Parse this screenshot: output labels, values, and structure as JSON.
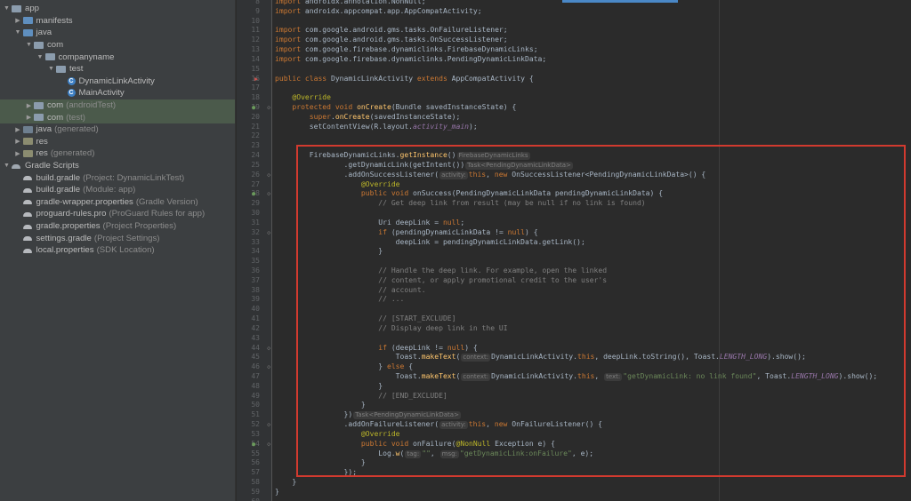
{
  "project_tree": [
    {
      "label": "app",
      "hint": "",
      "icon": "folder",
      "arrow": "down",
      "level": 0,
      "selected": false
    },
    {
      "label": "manifests",
      "hint": "",
      "icon": "folder-blue",
      "arrow": "right",
      "level": 1,
      "selected": false
    },
    {
      "label": "java",
      "hint": "",
      "icon": "folder-blue",
      "arrow": "down",
      "level": 1,
      "selected": false
    },
    {
      "label": "com",
      "hint": "",
      "icon": "folder",
      "arrow": "down",
      "level": 2,
      "selected": false
    },
    {
      "label": "companyname",
      "hint": "",
      "icon": "folder",
      "arrow": "down",
      "level": 3,
      "selected": false
    },
    {
      "label": "test",
      "hint": "",
      "icon": "folder",
      "arrow": "down",
      "level": 4,
      "selected": false
    },
    {
      "label": "DynamicLinkActivity",
      "hint": "",
      "icon": "class",
      "arrow": "none",
      "level": 5,
      "selected": false
    },
    {
      "label": "MainActivity",
      "hint": "",
      "icon": "class",
      "arrow": "none",
      "level": 5,
      "selected": false
    },
    {
      "label": "com",
      "hint": "(androidTest)",
      "icon": "folder",
      "arrow": "right",
      "level": 2,
      "selected": true
    },
    {
      "label": "com",
      "hint": "(test)",
      "icon": "folder",
      "arrow": "right",
      "level": 2,
      "selected": true
    },
    {
      "label": "java",
      "hint": "(generated)",
      "icon": "folder-dark",
      "arrow": "right",
      "level": 1,
      "selected": false
    },
    {
      "label": "res",
      "hint": "",
      "icon": "folder-res",
      "arrow": "right",
      "level": 1,
      "selected": false
    },
    {
      "label": "res",
      "hint": "(generated)",
      "icon": "folder-res",
      "arrow": "right",
      "level": 1,
      "selected": false
    },
    {
      "label": "Gradle Scripts",
      "hint": "",
      "icon": "gradle",
      "arrow": "down",
      "level": 0,
      "selected": false
    },
    {
      "label": "build.gradle",
      "hint": "(Project: DynamicLinkTest)",
      "icon": "gradle-file",
      "arrow": "none",
      "level": 1,
      "selected": false
    },
    {
      "label": "build.gradle",
      "hint": "(Module: app)",
      "icon": "gradle-file",
      "arrow": "none",
      "level": 1,
      "selected": false
    },
    {
      "label": "gradle-wrapper.properties",
      "hint": "(Gradle Version)",
      "icon": "gradle-file",
      "arrow": "none",
      "level": 1,
      "selected": false
    },
    {
      "label": "proguard-rules.pro",
      "hint": "(ProGuard Rules for app)",
      "icon": "gradle-file",
      "arrow": "none",
      "level": 1,
      "selected": false
    },
    {
      "label": "gradle.properties",
      "hint": "(Project Properties)",
      "icon": "gradle-file",
      "arrow": "none",
      "level": 1,
      "selected": false
    },
    {
      "label": "settings.gradle",
      "hint": "(Project Settings)",
      "icon": "gradle-file",
      "arrow": "none",
      "level": 1,
      "selected": false
    },
    {
      "label": "local.properties",
      "hint": "(SDK Location)",
      "icon": "gradle-file",
      "arrow": "none",
      "level": 1,
      "selected": false
    }
  ],
  "code_lines": [
    {
      "n": "8",
      "t": [
        [
          "k",
          "import "
        ],
        [
          "m",
          "androidx.annotation.NonNull;"
        ]
      ]
    },
    {
      "n": "9",
      "t": [
        [
          "k",
          "import "
        ],
        [
          "m",
          "androidx.appcompat.app.AppCompatActivity;"
        ]
      ]
    },
    {
      "n": "10",
      "t": []
    },
    {
      "n": "11",
      "t": [
        [
          "k",
          "import "
        ],
        [
          "m",
          "com.google.android.gms.tasks.OnFailureListener;"
        ]
      ]
    },
    {
      "n": "12",
      "t": [
        [
          "k",
          "import "
        ],
        [
          "m",
          "com.google.android.gms.tasks.OnSuccessListener;"
        ]
      ]
    },
    {
      "n": "13",
      "t": [
        [
          "k",
          "import "
        ],
        [
          "m",
          "com.google.firebase.dynamiclinks.FirebaseDynamicLinks;"
        ]
      ]
    },
    {
      "n": "14",
      "t": [
        [
          "k",
          "import "
        ],
        [
          "m",
          "com.google.firebase.dynamiclinks.PendingDynamicLinkData;"
        ]
      ]
    },
    {
      "n": "15",
      "t": []
    },
    {
      "n": "16",
      "t": [
        [
          "k",
          "public class "
        ],
        [
          "m",
          "DynamicLinkActivity "
        ],
        [
          "k",
          "extends "
        ],
        [
          "m",
          "AppCompatActivity {"
        ]
      ]
    },
    {
      "n": "17",
      "t": []
    },
    {
      "n": "18",
      "t": [
        [
          "m",
          "    "
        ],
        [
          "a",
          "@Override"
        ]
      ]
    },
    {
      "n": "19",
      "t": [
        [
          "m",
          "    "
        ],
        [
          "k",
          "protected void "
        ],
        [
          "f",
          "onCreate"
        ],
        [
          "m",
          "(Bundle savedInstanceState) {"
        ]
      ]
    },
    {
      "n": "20",
      "t": [
        [
          "m",
          "        "
        ],
        [
          "k",
          "super"
        ],
        [
          "m",
          "."
        ],
        [
          "f",
          "onCreate"
        ],
        [
          "m",
          "(savedInstanceState);"
        ]
      ]
    },
    {
      "n": "21",
      "t": [
        [
          "m",
          "        setContentView(R.layout."
        ],
        [
          "st",
          "activity_main"
        ],
        [
          "m",
          ");"
        ]
      ]
    },
    {
      "n": "22",
      "t": []
    },
    {
      "n": "23",
      "t": []
    },
    {
      "n": "24",
      "t": [
        [
          "m",
          "        FirebaseDynamicLinks."
        ],
        [
          "f",
          "getInstance"
        ],
        [
          "m",
          "()"
        ],
        [
          "ph",
          "FirebaseDynamicLinks"
        ]
      ]
    },
    {
      "n": "25",
      "t": [
        [
          "m",
          "                .getDynamicLink(getIntent())"
        ],
        [
          "ph",
          "Task<PendingDynamicLinkData>"
        ]
      ]
    },
    {
      "n": "26",
      "t": [
        [
          "m",
          "                .addOnSuccessListener("
        ],
        [
          "ph",
          "activity:"
        ],
        [
          "k",
          "this"
        ],
        [
          "m",
          ", "
        ],
        [
          "k",
          "new "
        ],
        [
          "m",
          "OnSuccessListener<PendingDynamicLinkData>() {"
        ]
      ]
    },
    {
      "n": "27",
      "t": [
        [
          "m",
          "                    "
        ],
        [
          "a",
          "@Override"
        ]
      ]
    },
    {
      "n": "28",
      "t": [
        [
          "m",
          "                    "
        ],
        [
          "k",
          "public void "
        ],
        [
          "m",
          "onSuccess(PendingDynamicLinkData pendingDynamicLinkData) {"
        ]
      ]
    },
    {
      "n": "29",
      "t": [
        [
          "m",
          "                        "
        ],
        [
          "c",
          "// Get deep link from result (may be null if no link is found)"
        ]
      ]
    },
    {
      "n": "30",
      "t": []
    },
    {
      "n": "31",
      "t": [
        [
          "m",
          "                        Uri deepLink = "
        ],
        [
          "k",
          "null"
        ],
        [
          "m",
          ";"
        ]
      ]
    },
    {
      "n": "32",
      "t": [
        [
          "m",
          "                        "
        ],
        [
          "k",
          "if "
        ],
        [
          "m",
          "(pendingDynamicLinkData != "
        ],
        [
          "k",
          "null"
        ],
        [
          "m",
          ") {"
        ]
      ]
    },
    {
      "n": "33",
      "t": [
        [
          "m",
          "                            deepLink = pendingDynamicLinkData.getLink();"
        ]
      ]
    },
    {
      "n": "34",
      "t": [
        [
          "m",
          "                        }"
        ]
      ]
    },
    {
      "n": "35",
      "t": []
    },
    {
      "n": "36",
      "t": [
        [
          "m",
          "                        "
        ],
        [
          "c",
          "// Handle the deep link. For example, open the linked"
        ]
      ]
    },
    {
      "n": "37",
      "t": [
        [
          "m",
          "                        "
        ],
        [
          "c",
          "// content, or apply promotional credit to the user's"
        ]
      ]
    },
    {
      "n": "38",
      "t": [
        [
          "m",
          "                        "
        ],
        [
          "c",
          "// account."
        ]
      ]
    },
    {
      "n": "39",
      "t": [
        [
          "m",
          "                        "
        ],
        [
          "c",
          "// ..."
        ]
      ]
    },
    {
      "n": "40",
      "t": []
    },
    {
      "n": "41",
      "t": [
        [
          "m",
          "                        "
        ],
        [
          "c",
          "// [START_EXCLUDE]"
        ]
      ]
    },
    {
      "n": "42",
      "t": [
        [
          "m",
          "                        "
        ],
        [
          "c",
          "// Display deep link in the UI"
        ]
      ]
    },
    {
      "n": "43",
      "t": []
    },
    {
      "n": "44",
      "t": [
        [
          "m",
          "                        "
        ],
        [
          "k",
          "if "
        ],
        [
          "m",
          "(deepLink != "
        ],
        [
          "k",
          "null"
        ],
        [
          "m",
          ") {"
        ]
      ]
    },
    {
      "n": "45",
      "t": [
        [
          "m",
          "                            Toast."
        ],
        [
          "f",
          "makeText"
        ],
        [
          "m",
          "("
        ],
        [
          "ph",
          "context:"
        ],
        [
          "m",
          "DynamicLinkActivity."
        ],
        [
          "k",
          "this"
        ],
        [
          "m",
          ", deepLink.toString(), Toast."
        ],
        [
          "st",
          "LENGTH_LONG"
        ],
        [
          "m",
          ").show();"
        ]
      ]
    },
    {
      "n": "46",
      "t": [
        [
          "m",
          "                        } "
        ],
        [
          "k",
          "else "
        ],
        [
          "m",
          "{"
        ]
      ]
    },
    {
      "n": "47",
      "t": [
        [
          "m",
          "                            Toast."
        ],
        [
          "f",
          "makeText"
        ],
        [
          "m",
          "("
        ],
        [
          "ph",
          "context:"
        ],
        [
          "m",
          "DynamicLinkActivity."
        ],
        [
          "k",
          "this"
        ],
        [
          "m",
          ", "
        ],
        [
          "ph",
          "text:"
        ],
        [
          "s",
          "\"getDynamicLink: no link found\""
        ],
        [
          "m",
          ", Toast."
        ],
        [
          "st",
          "LENGTH_LONG"
        ],
        [
          "m",
          ").show();"
        ]
      ]
    },
    {
      "n": "48",
      "t": [
        [
          "m",
          "                        }"
        ]
      ]
    },
    {
      "n": "49",
      "t": [
        [
          "m",
          "                        "
        ],
        [
          "c",
          "// [END_EXCLUDE]"
        ]
      ]
    },
    {
      "n": "50",
      "t": [
        [
          "m",
          "                    }"
        ]
      ]
    },
    {
      "n": "51",
      "t": [
        [
          "m",
          "                })"
        ],
        [
          "ph",
          "Task<PendingDynamicLinkData>"
        ]
      ]
    },
    {
      "n": "52",
      "t": [
        [
          "m",
          "                .addOnFailureListener("
        ],
        [
          "ph",
          "activity:"
        ],
        [
          "k",
          "this"
        ],
        [
          "m",
          ", "
        ],
        [
          "k",
          "new "
        ],
        [
          "m",
          "OnFailureListener() {"
        ]
      ]
    },
    {
      "n": "53",
      "t": [
        [
          "m",
          "                    "
        ],
        [
          "a",
          "@Override"
        ]
      ]
    },
    {
      "n": "54",
      "t": [
        [
          "m",
          "                    "
        ],
        [
          "k",
          "public void "
        ],
        [
          "m",
          "onFailure("
        ],
        [
          "a",
          "@NonNull "
        ],
        [
          "m",
          "Exception e) {"
        ]
      ]
    },
    {
      "n": "55",
      "t": [
        [
          "m",
          "                        Log."
        ],
        [
          "f",
          "w"
        ],
        [
          "m",
          "("
        ],
        [
          "ph",
          "tag:"
        ],
        [
          "s",
          "\"\""
        ],
        [
          "m",
          ", "
        ],
        [
          "ph",
          "msg:"
        ],
        [
          "s",
          "\"getDynamicLink:onFailure\""
        ],
        [
          "m",
          ", e);"
        ]
      ]
    },
    {
      "n": "56",
      "t": [
        [
          "m",
          "                    }"
        ]
      ]
    },
    {
      "n": "57",
      "t": [
        [
          "m",
          "                });"
        ]
      ]
    },
    {
      "n": "58",
      "t": [
        [
          "m",
          "    }"
        ]
      ]
    },
    {
      "n": "59",
      "t": [
        [
          "m",
          "}"
        ]
      ]
    },
    {
      "n": "60",
      "t": []
    }
  ],
  "gutter_marks": [
    {
      "line": "16",
      "symbol": "▶",
      "kind": "over"
    },
    {
      "line": "19",
      "symbol": "●",
      "kind": "impl"
    },
    {
      "line": "28",
      "symbol": "●",
      "kind": "impl"
    },
    {
      "line": "54",
      "symbol": "●",
      "kind": "impl"
    }
  ],
  "colors": {
    "highlight_box": "#d23a2f",
    "editor_bg": "#2b2b2b",
    "tree_bg": "#3c3f41"
  }
}
